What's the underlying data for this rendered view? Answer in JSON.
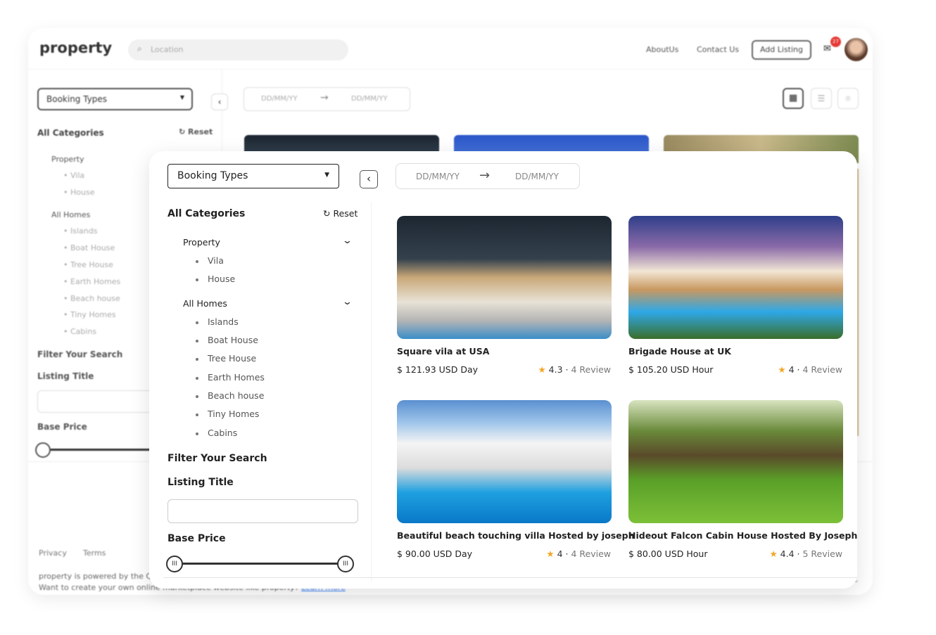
{
  "header": {
    "logo": "property",
    "search_placeholder": "Location",
    "nav": [
      "AboutUs",
      "Contact Us"
    ],
    "add_listing": "Add Listing",
    "notification_count": "27"
  },
  "filters": {
    "booking_types": "Booking Types",
    "date_from": "DD/MM/YY",
    "date_to": "DD/MM/YY",
    "all_categories": "All Categories",
    "reset": "Reset",
    "groups": [
      {
        "label": "Property",
        "items": [
          "Vila",
          "House"
        ]
      },
      {
        "label": "All Homes",
        "items": [
          "Islands",
          "Boat House",
          "Tree House",
          "Earth Homes",
          "Beach house",
          "Tiny Homes",
          "Cabins"
        ]
      }
    ],
    "filter_your_search": "Filter Your Search",
    "listing_title": "Listing Title",
    "listing_title_value": "",
    "base_price": "Base Price",
    "price_range": [
      0,
      100
    ]
  },
  "listings": [
    {
      "title": "Square vila at USA",
      "price": "$ 121.93 USD Day",
      "rating": "4.3",
      "reviews": "4 Review"
    },
    {
      "title": "Brigade House at UK",
      "price": "$ 105.20 USD Hour",
      "rating": "4",
      "reviews": "4 Review"
    },
    {
      "title": "Beautiful beach touching villa Hosted by joseph",
      "price": "$ 90.00 USD Day",
      "rating": "4",
      "reviews": "4 Review"
    },
    {
      "title": "Hideout Falcon Cabin House Hosted By Joseph",
      "price": "$ 80.00 USD Hour",
      "rating": "4.4",
      "reviews": "5 Review"
    }
  ],
  "footer": {
    "links": [
      "Privacy",
      "Terms"
    ],
    "powered": "property is powered by the Q",
    "cta": "Want to create your own online marketplace website like property?",
    "learn_more": "Learn more"
  },
  "colors": {
    "accent": "#f5a623",
    "badge": "#e53935",
    "link": "#3b82f6"
  }
}
